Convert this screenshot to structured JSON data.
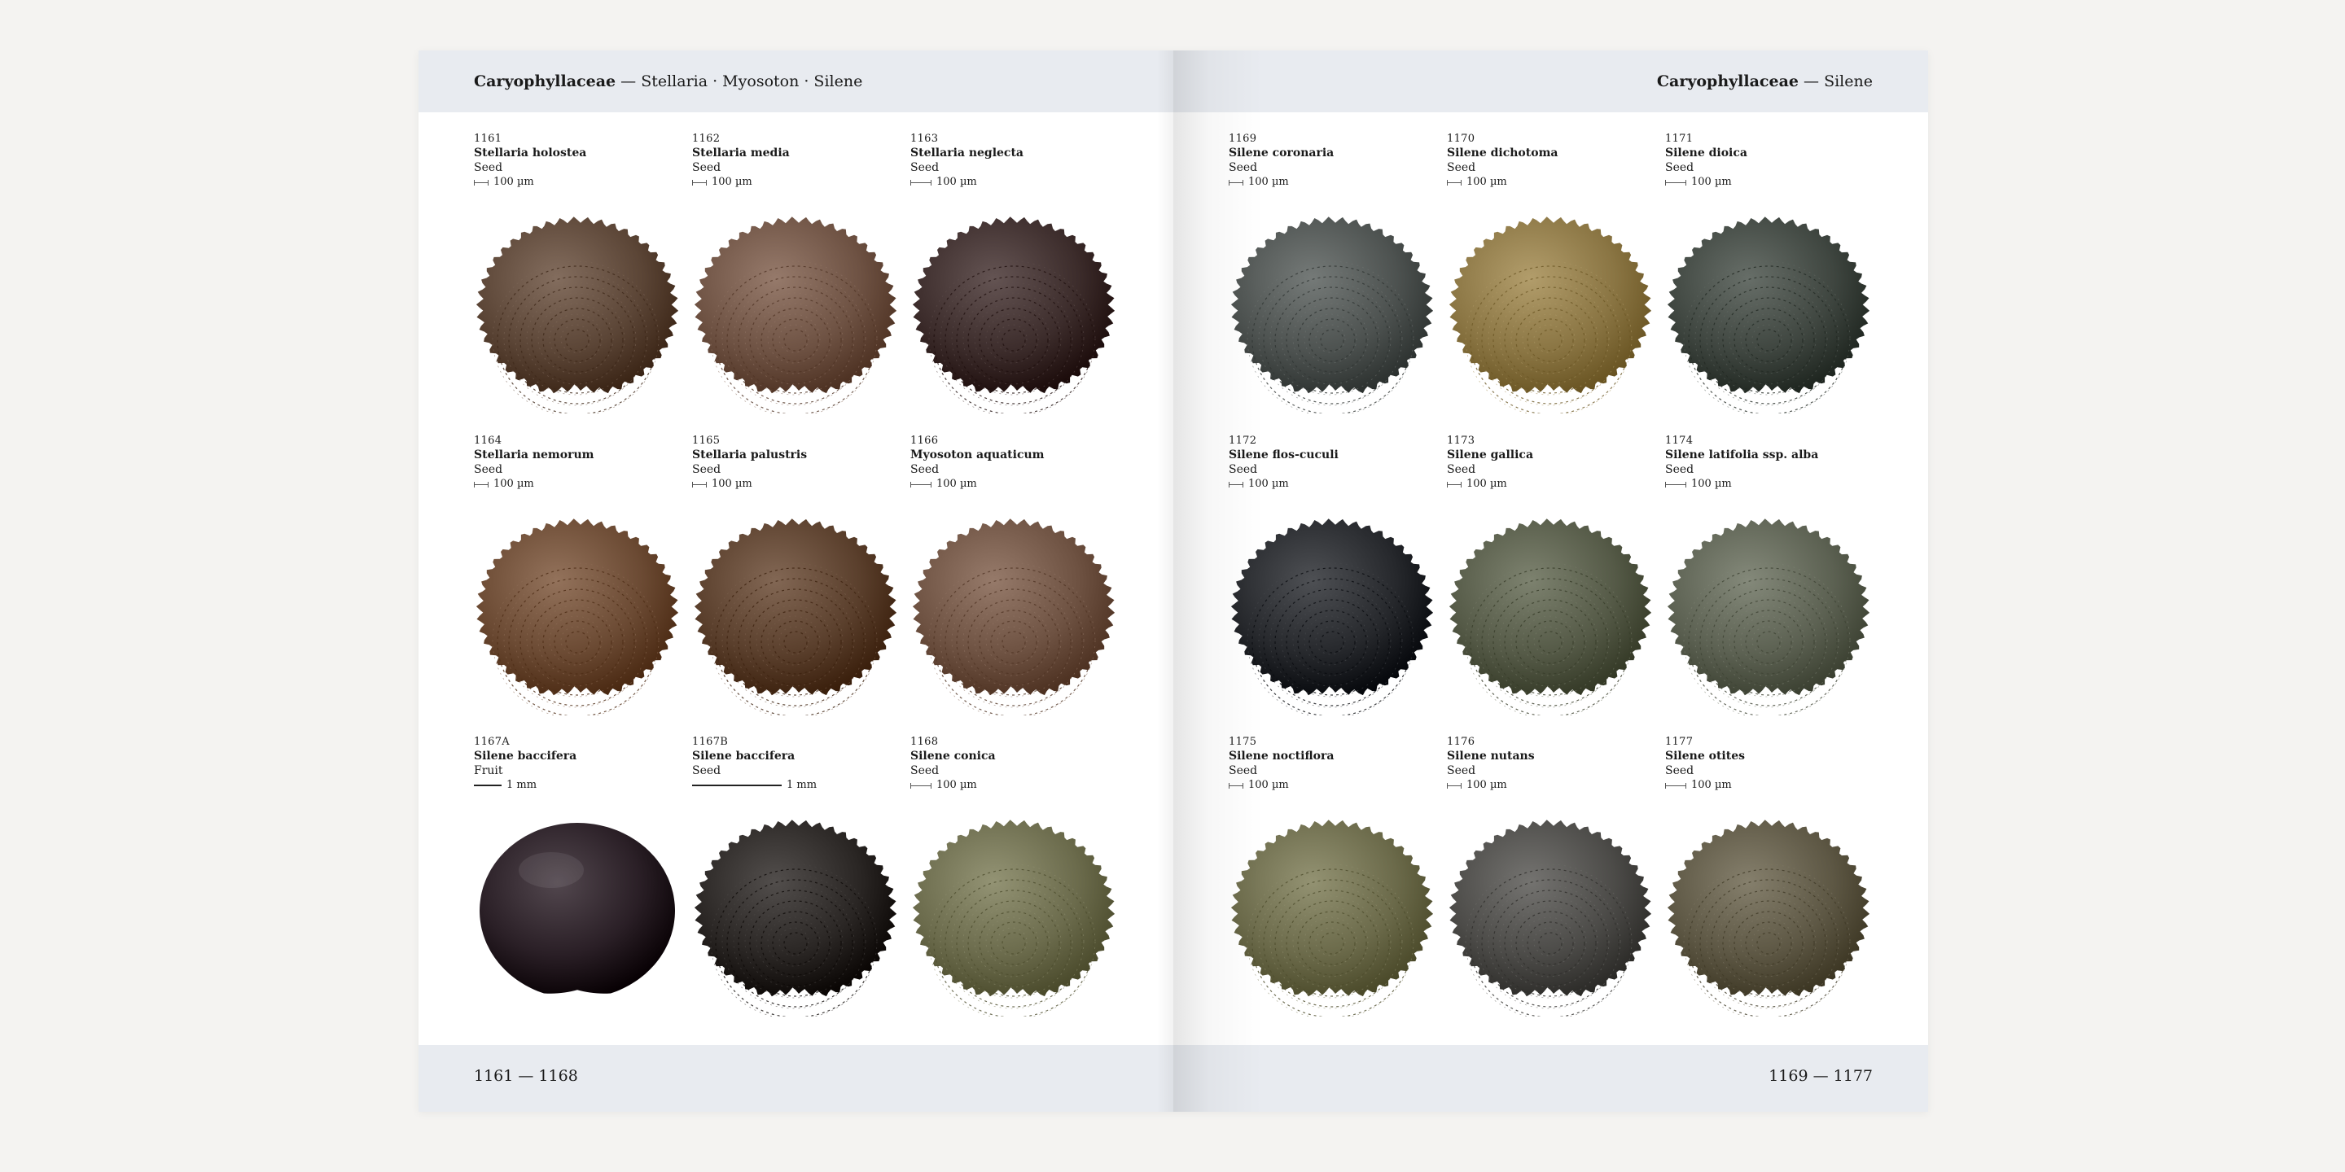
{
  "left_page": {
    "header": {
      "family": "Caryophyllaceae",
      "separator": " — ",
      "genera": "Stellaria · Myosoton · Silene"
    },
    "footer": {
      "range": "1161 — 1168"
    },
    "specimens": [
      {
        "number": "1161",
        "name": "Stellaria holostea",
        "part": "Seed",
        "scale": "100 µm",
        "color": "#5b4536"
      },
      {
        "number": "1162",
        "name": "Stellaria media",
        "part": "Seed",
        "scale": "100 µm",
        "color": "#6e5243"
      },
      {
        "number": "1163",
        "name": "Stellaria neglecta",
        "part": "Seed",
        "scale": "100 µm",
        "color": "#3c2c2b"
      },
      {
        "number": "1164",
        "name": "Stellaria nemorum",
        "part": "Seed",
        "scale": "100 µm",
        "color": "#6b4a33"
      },
      {
        "number": "1165",
        "name": "Stellaria palustris",
        "part": "Seed",
        "scale": "100 µm",
        "color": "#5a3f2c"
      },
      {
        "number": "1166",
        "name": "Myosoton aquaticum",
        "part": "Seed",
        "scale": "100 µm",
        "color": "#6e5242"
      },
      {
        "number": "1167A",
        "name": "Silene baccifera",
        "part": "Fruit",
        "scale": "1 mm",
        "color": "#2a1f26"
      },
      {
        "number": "1167B",
        "name": "Silene baccifera",
        "part": "Seed",
        "scale": "1 mm",
        "color": "#2a2624"
      },
      {
        "number": "1168",
        "name": "Silene conica",
        "part": "Seed",
        "scale": "100 µm",
        "color": "#6b6b4c"
      }
    ]
  },
  "right_page": {
    "header": {
      "family": "Caryophyllaceae",
      "separator": " — ",
      "genera": "Silene"
    },
    "footer": {
      "range": "1169 — 1177"
    },
    "specimens": [
      {
        "number": "1169",
        "name": "Silene coronaria",
        "part": "Seed",
        "scale": "100 µm",
        "color": "#4d5250"
      },
      {
        "number": "1170",
        "name": "Silene dichotoma",
        "part": "Seed",
        "scale": "100 µm",
        "color": "#8a7543"
      },
      {
        "number": "1171",
        "name": "Silene dioica",
        "part": "Seed",
        "scale": "100 µm",
        "color": "#3f4640"
      },
      {
        "number": "1172",
        "name": "Silene flos-cuculi",
        "part": "Seed",
        "scale": "100 µm",
        "color": "#26282c"
      },
      {
        "number": "1173",
        "name": "Silene gallica",
        "part": "Seed",
        "scale": "100 µm",
        "color": "#555a47"
      },
      {
        "number": "1174",
        "name": "Silene latifolia ssp. alba",
        "part": "Seed",
        "scale": "100 µm",
        "color": "#5c6152"
      },
      {
        "number": "1175",
        "name": "Silene noctiflora",
        "part": "Seed",
        "scale": "100 µm",
        "color": "#6b6a4a"
      },
      {
        "number": "1176",
        "name": "Silene nutans",
        "part": "Seed",
        "scale": "100 µm",
        "color": "#4c4b48"
      },
      {
        "number": "1177",
        "name": "Silene otites",
        "part": "Seed",
        "scale": "100 µm",
        "color": "#5d5744"
      }
    ]
  }
}
